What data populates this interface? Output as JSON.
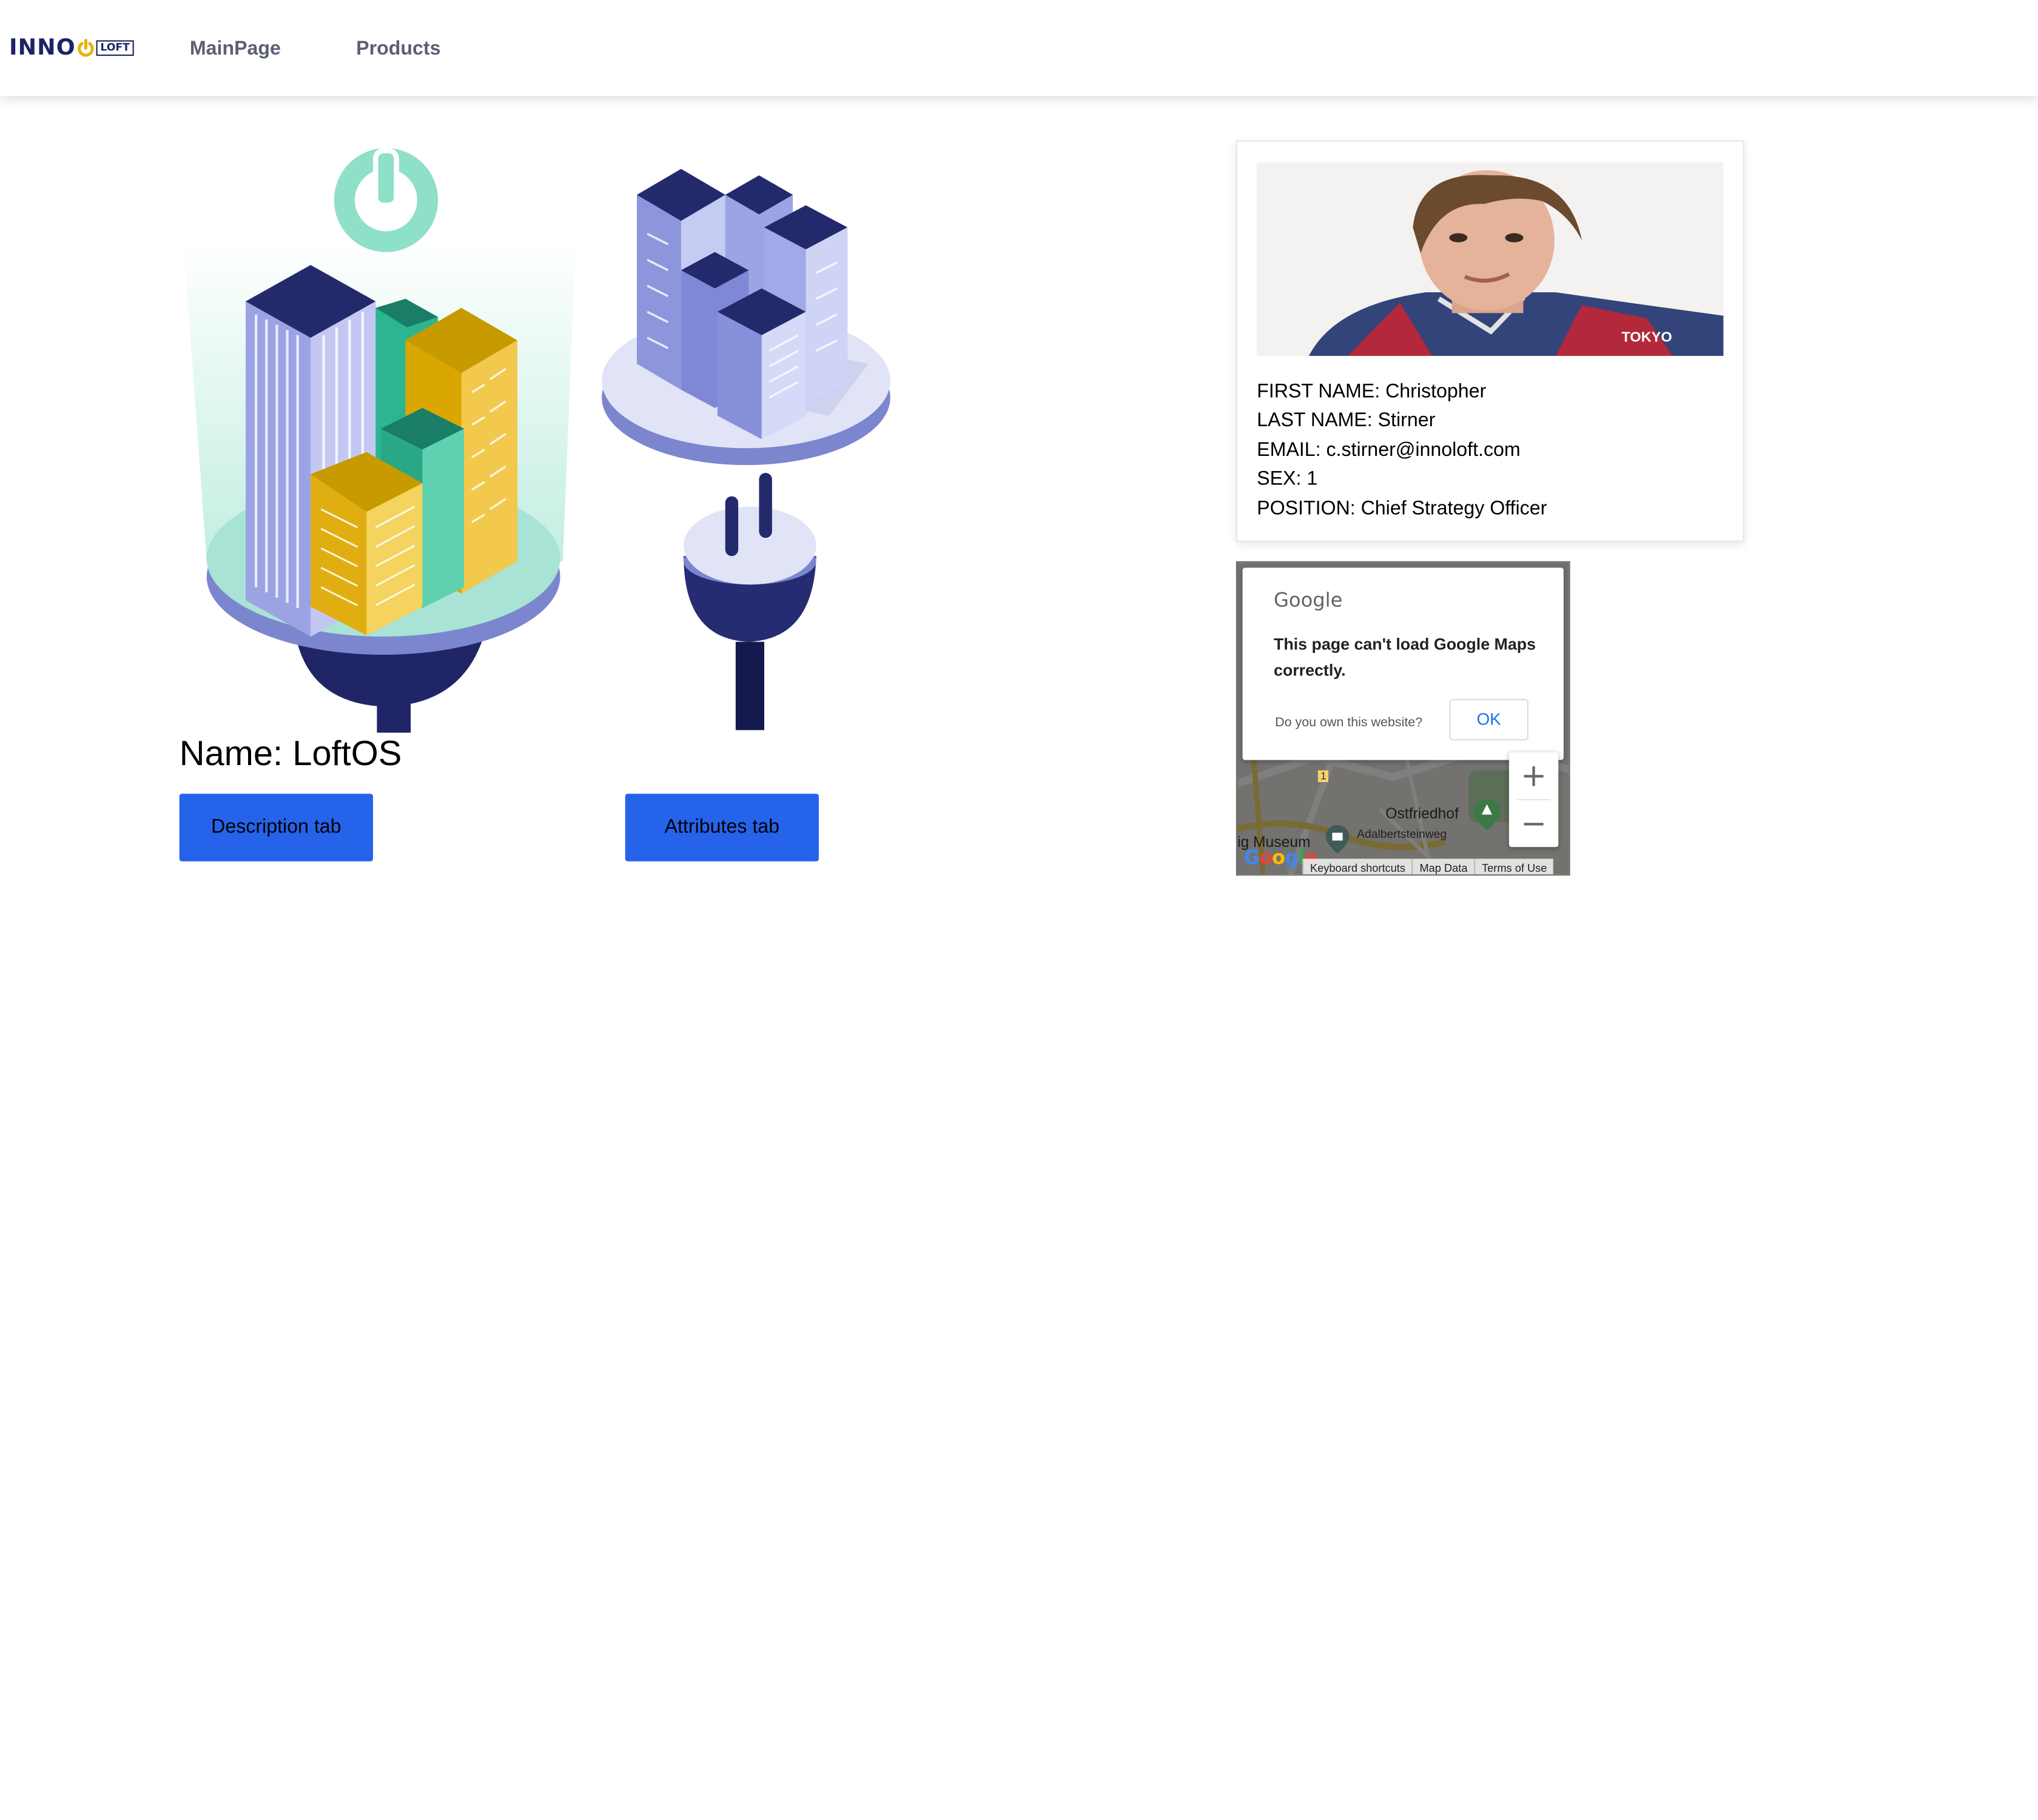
{
  "nav": {
    "logo_text": "INNO",
    "logo_box": "LOFT",
    "links": [
      "MainPage",
      "Products"
    ]
  },
  "product": {
    "name": "Name: LoftOS",
    "description_button": "Description tab",
    "attributes_button": "Attributes tab"
  },
  "user": {
    "first_name": "FIRST NAME: Christopher",
    "last_name": "LAST NAME: Stirner",
    "email": "EMAIL: c.stirner@innoloft.com",
    "sex": "SEX: 1",
    "position": "POSITION: Chief Strategy Officer",
    "shirt_text": "TOKYO"
  },
  "map": {
    "dialog_brand": "Google",
    "dialog_message": "This page can't load Google Maps correctly.",
    "dialog_question": "Do you own this website?",
    "dialog_ok": "OK",
    "zoom_in": "+",
    "zoom_out": "−",
    "labels": [
      "Ostfriedhof",
      "Adalbertsteinweg",
      "ig Museum",
      "1"
    ],
    "footer": [
      "Keyboard shortcuts",
      "Map Data",
      "Terms of Use"
    ],
    "watermark": "Google"
  },
  "colors": {
    "primary_button": "#2563eb",
    "brand_navy": "#1d2463",
    "brand_yellow": "#e8b400",
    "link_gray": "#5b5f73"
  }
}
